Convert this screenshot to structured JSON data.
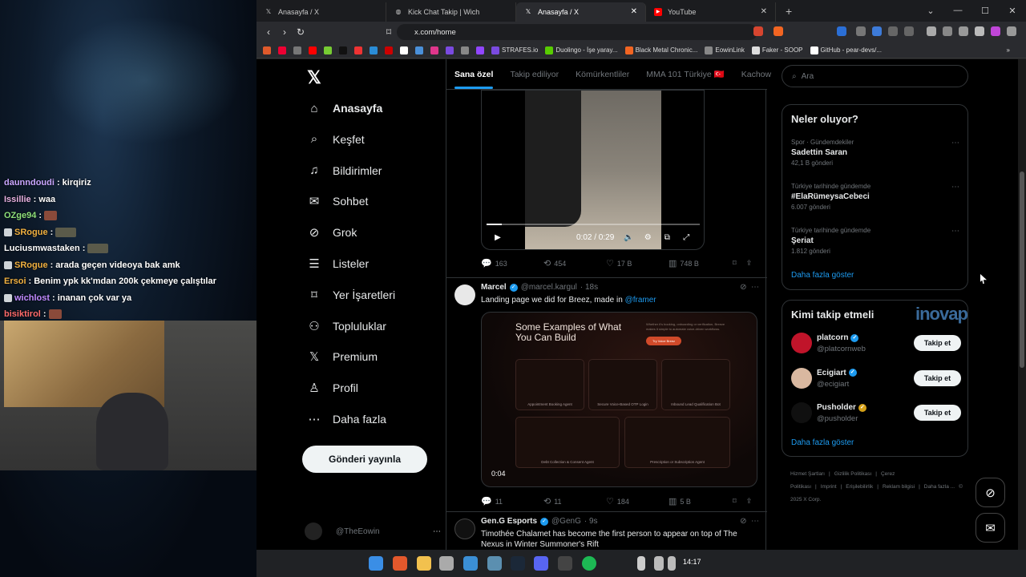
{
  "stream": {
    "chat": [
      {
        "user": "daunndoudi",
        "msg": ": kirqiriz",
        "color": "#c9a6ff",
        "emote": false,
        "badge": false
      },
      {
        "user": "Issillie",
        "msg": ": waa",
        "color": "#e7b0e0",
        "emote": false,
        "badge": false
      },
      {
        "user": "OZge94",
        "msg": ":",
        "color": "#8fe07a",
        "emote": true,
        "badge": false
      },
      {
        "user": "SRogue",
        "msg": ":",
        "color": "#f0b040",
        "emote": true,
        "badge": true
      },
      {
        "user": "Luciusmwastaken",
        "msg": ":",
        "color": "#ffffff",
        "emote": true,
        "badge": false
      },
      {
        "user": "SRogue",
        "msg": ": arada geçen videoya bak amk",
        "color": "#f0b040",
        "emote": false,
        "badge": true
      },
      {
        "user": "Ersoi",
        "msg": ": Benim ypk kk'mdan 200k çekmeye çalıştılar",
        "color": "#f0b040",
        "emote": false,
        "badge": false
      },
      {
        "user": "wichlost",
        "msg": ": inanan çok var ya",
        "color": "#c08aff",
        "emote": false,
        "badge": true
      },
      {
        "user": "bisiktirol",
        "msg": ":",
        "color": "#ff6a6a",
        "emote": true,
        "badge": false
      }
    ]
  },
  "browser": {
    "tabs": [
      {
        "label": "Anasayfa / X",
        "active": false,
        "icon": "x-icon"
      },
      {
        "label": "Kick Chat Takip | Wich",
        "active": false,
        "icon": "globe-icon"
      },
      {
        "label": "Anasayfa / X",
        "active": true,
        "icon": "x-icon"
      },
      {
        "label": "YouTube",
        "active": false,
        "icon": "youtube-icon"
      }
    ],
    "url": "x.com/home",
    "bookmarks": [
      "STRAFES.io",
      "Duolingo - İşe yaray...",
      "Black Metal Chronic...",
      "EowinLink",
      "Faker - SOOP",
      "GitHub - pear-devs/..."
    ],
    "watermark": "inovap"
  },
  "x": {
    "nav": [
      {
        "label": "Anasayfa",
        "icon": "home-icon",
        "glyph": "⌂",
        "bold": true
      },
      {
        "label": "Keşfet",
        "icon": "search-icon",
        "glyph": "⌕",
        "bold": false
      },
      {
        "label": "Bildirimler",
        "icon": "bell-icon",
        "glyph": "♫",
        "bold": false
      },
      {
        "label": "Sohbet",
        "icon": "mail-icon",
        "glyph": "✉",
        "bold": false
      },
      {
        "label": "Grok",
        "icon": "grok-icon",
        "glyph": "⊘",
        "bold": false
      },
      {
        "label": "Listeler",
        "icon": "list-icon",
        "glyph": "☰",
        "bold": false
      },
      {
        "label": "Yer İşaretleri",
        "icon": "bookmark-icon",
        "glyph": "⌑",
        "bold": false
      },
      {
        "label": "Topluluklar",
        "icon": "communities-icon",
        "glyph": "⚇",
        "bold": false
      },
      {
        "label": "Premium",
        "icon": "x-premium-icon",
        "glyph": "𝕏",
        "bold": false
      },
      {
        "label": "Profil",
        "icon": "profile-icon",
        "glyph": "♙",
        "bold": false
      },
      {
        "label": "Daha fazla",
        "icon": "more-circle-icon",
        "glyph": "⋯",
        "bold": false
      }
    ],
    "post_button": "Gönderi yayınla",
    "account": "@TheEowin",
    "feed_tabs": [
      "Sana özel",
      "Takip ediliyor",
      "Kömürkentliler",
      "MMA 101 Türkiye 🇹🇷",
      "Kachow"
    ],
    "video": {
      "time": "0:02 / 0:29",
      "progress": 0.07
    },
    "tweet0_stats": {
      "replies": "163",
      "retweets": "454",
      "likes": "17 B",
      "views": "748 B"
    },
    "tweet1": {
      "name": "Marcel",
      "handle": "@marcel.kargul",
      "time": "· 18s",
      "text": "Landing page we did for Breez, made in ",
      "mention": "@framer",
      "card": {
        "title": "Some Examples of What You Can Build",
        "sub": "Whether it's booking, onboarding or verification, Breeze makes it simple to automate voice-driven workflows.",
        "btn": "Try Voice Breez",
        "boxes": [
          "Appointment Booking Agent",
          "Secure Voice-Based OTP Login",
          "Inbound Lead Qualification Bot",
          "Debt Collection & Consent Agent",
          "Prescription or Subscription Agent"
        ],
        "duration": "0:04"
      },
      "stats": {
        "replies": "11",
        "retweets": "11",
        "likes": "184",
        "views": "5 B"
      }
    },
    "tweet2": {
      "name": "Gen.G Esports",
      "handle": "@GenG",
      "time": "· 9s",
      "text": "Timothée Chalamet has become the first person to appear on top of The Nexus in Winter Summoner's Rift"
    },
    "search_placeholder": "Ara",
    "trends_title": "Neler oluyor?",
    "trends": [
      {
        "cat": "Spor · Gündemdekiler",
        "title": "Sadettin Saran",
        "count": "42,1 B gönderi"
      },
      {
        "cat": "Türkiye tarihinde gündemde",
        "title": "#ElaRümeysaCebeci",
        "count": "6.007 gönderi"
      },
      {
        "cat": "Türkiye tarihinde gündemde",
        "title": "Şeriat",
        "count": "1.812 gönderi"
      }
    ],
    "show_more": "Daha fazla göster",
    "who_title": "Kimi takip etmeli",
    "who": [
      {
        "name": "platcorn",
        "handle": "@platcornweb",
        "gold": false,
        "avatar": "#c0142a"
      },
      {
        "name": "Ecigiart",
        "handle": "@ecigiart",
        "gold": false,
        "avatar": "#d9b8a0"
      },
      {
        "name": "Pusholder",
        "handle": "@pusholder",
        "gold": true,
        "avatar": "#101010"
      }
    ],
    "follow_label": "Takip et",
    "footer": [
      "Hizmet Şartları",
      "|",
      "Gizlilik Politikası",
      "|",
      "Çerez Politikası",
      "|",
      "Imprint",
      "|",
      "Erişilebilirlik",
      "|",
      "Reklam bilgisi",
      "|",
      "Daha fazla ...",
      "© 2025 X Corp."
    ]
  },
  "taskbar": {
    "clock": "14:17"
  }
}
